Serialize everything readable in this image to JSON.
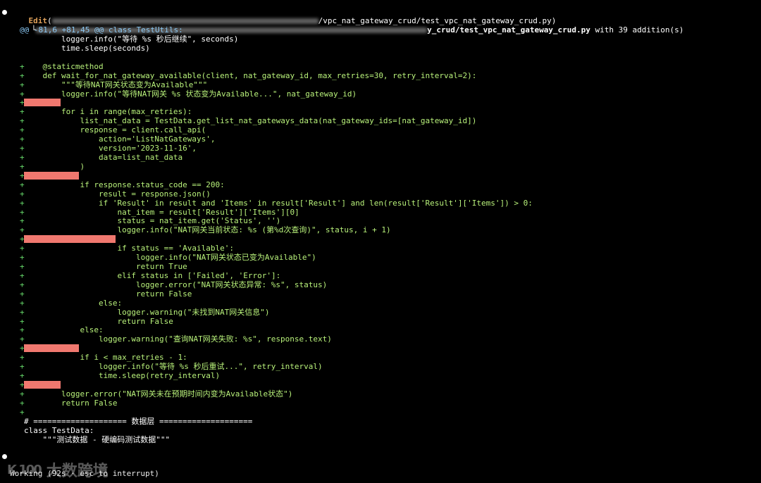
{
  "header": {
    "tool": "Edit",
    "open_paren": "(",
    "path_suffix": "/vpc_nat_gateway_crud/test_vpc_nat_gateway_crud.py)",
    "subline_prefix": "└",
    "subline_file": "y_crud/test_vpc_nat_gateway_crud.py",
    "subline_rest": " with 39 addition(s)"
  },
  "hunk": "@@ -81,6 +81,45 @@ class TestUtils:",
  "code_lines": [
    {
      "marker": "",
      "text": "        logger.info(\"等待 %s 秒后继续\", seconds)"
    },
    {
      "marker": "",
      "text": "        time.sleep(seconds)"
    },
    {
      "marker": "",
      "text": ""
    },
    {
      "marker": "+",
      "text": "    @staticmethod"
    },
    {
      "marker": "+",
      "text": "    def wait_for_nat_gateway_available(client, nat_gateway_id, max_retries=30, retry_interval=2):"
    },
    {
      "marker": "+",
      "text": "        \"\"\"等待NAT网关状态变为Available\"\"\""
    },
    {
      "marker": "+",
      "text": "        logger.info(\"等待NAT网关 %s 状态变为Available...\", nat_gateway_id)"
    },
    {
      "marker": "+",
      "text": ""
    },
    {
      "marker": "+",
      "text": "        for i in range(max_retries):"
    },
    {
      "marker": "+",
      "text": "            list_nat_data = TestData.get_list_nat_gateways_data(nat_gateway_ids=[nat_gateway_id])"
    },
    {
      "marker": "+",
      "text": "            response = client.call_api("
    },
    {
      "marker": "+",
      "text": "                action='ListNatGateways',"
    },
    {
      "marker": "+",
      "text": "                version='2023-11-16',"
    },
    {
      "marker": "+",
      "text": "                data=list_nat_data"
    },
    {
      "marker": "+",
      "text": "            )"
    },
    {
      "marker": "+",
      "text": ""
    },
    {
      "marker": "+",
      "text": "            if response.status_code == 200:"
    },
    {
      "marker": "+",
      "text": "                result = response.json()"
    },
    {
      "marker": "+",
      "text": "                if 'Result' in result and 'Items' in result['Result'] and len(result['Result']['Items']) > 0:"
    },
    {
      "marker": "+",
      "text": "                    nat_item = result['Result']['Items'][0]"
    },
    {
      "marker": "+",
      "text": "                    status = nat_item.get('Status', '')"
    },
    {
      "marker": "+",
      "text": "                    logger.info(\"NAT网关当前状态: %s (第%d次查询)\", status, i + 1)"
    },
    {
      "marker": "+",
      "text": ""
    },
    {
      "marker": "+",
      "text": "                    if status == 'Available':"
    },
    {
      "marker": "+",
      "text": "                        logger.info(\"NAT网关状态已变为Available\")"
    },
    {
      "marker": "+",
      "text": "                        return True"
    },
    {
      "marker": "+",
      "text": "                    elif status in ['Failed', 'Error']:"
    },
    {
      "marker": "+",
      "text": "                        logger.error(\"NAT网关状态异常: %s\", status)"
    },
    {
      "marker": "+",
      "text": "                        return False"
    },
    {
      "marker": "+",
      "text": "                else:"
    },
    {
      "marker": "+",
      "text": "                    logger.warning(\"未找到NAT网关信息\")"
    },
    {
      "marker": "+",
      "text": "                    return False"
    },
    {
      "marker": "+",
      "text": "            else:"
    },
    {
      "marker": "+",
      "text": "                logger.warning(\"查询NAT网关失败: %s\", response.text)"
    },
    {
      "marker": "+",
      "text": ""
    },
    {
      "marker": "+",
      "text": "            if i < max_retries - 1:"
    },
    {
      "marker": "+",
      "text": "                logger.info(\"等待 %s 秒后重试...\", retry_interval)"
    },
    {
      "marker": "+",
      "text": "                time.sleep(retry_interval)"
    },
    {
      "marker": "+",
      "text": ""
    },
    {
      "marker": "+",
      "text": "        logger.error(\"NAT网关未在预期时间内变为Available状态\")"
    },
    {
      "marker": "+",
      "text": "        return False"
    },
    {
      "marker": "+",
      "text": ""
    },
    {
      "marker": "",
      "text": "# ==================== 数据层 ===================="
    },
    {
      "marker": "",
      "text": "class TestData:"
    },
    {
      "marker": "",
      "text": "    \"\"\"测试数据 - 硬编码测试数据\"\"\""
    }
  ],
  "status": {
    "text": "Working (92s · esc to interrupt)"
  },
  "watermark": {
    "logo": "K 100",
    "text": "大数跨境"
  },
  "colors": {
    "background": "#000000",
    "diff_added_text": "#b8f17a",
    "diff_marker": "#66d96a",
    "blank_line_highlight": "#f0786f",
    "tool_name": "#e0a15a",
    "hunk_header": "#8ac7f2"
  }
}
